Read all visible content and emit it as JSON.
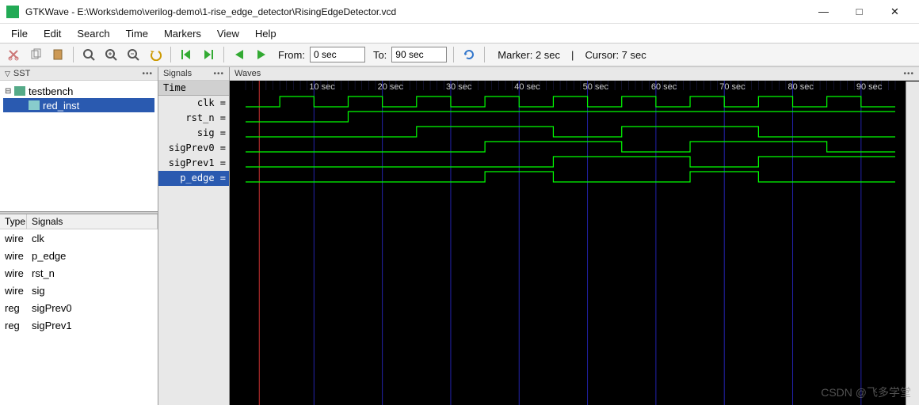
{
  "window": {
    "app": "GTKWave",
    "title": "GTKWave - E:\\Works\\demo\\verilog-demo\\1-rise_edge_detector\\RisingEdgeDetector.vcd"
  },
  "menu": [
    "File",
    "Edit",
    "Search",
    "Time",
    "Markers",
    "View",
    "Help"
  ],
  "toolbar": {
    "from_label": "From:",
    "from_value": "0 sec",
    "to_label": "To:",
    "to_value": "90 sec",
    "marker": "Marker: 2 sec",
    "cursor": "Cursor: 7 sec"
  },
  "panels": {
    "sst": "SST",
    "signals": "Signals",
    "waves": "Waves",
    "time": "Time"
  },
  "tree": {
    "testbench": "testbench",
    "red_inst": "red_inst"
  },
  "sigcols": {
    "type": "Type",
    "signals": "Signals"
  },
  "siglist": [
    {
      "t": "wire",
      "n": "clk"
    },
    {
      "t": "wire",
      "n": "p_edge"
    },
    {
      "t": "wire",
      "n": "rst_n"
    },
    {
      "t": "wire",
      "n": "sig"
    },
    {
      "t": "reg",
      "n": "sigPrev0"
    },
    {
      "t": "reg",
      "n": "sigPrev1"
    }
  ],
  "signames": [
    {
      "n": "clk =",
      "sel": false
    },
    {
      "n": "rst_n =",
      "sel": false
    },
    {
      "n": "sig =",
      "sel": false
    },
    {
      "n": "sigPrev0 =",
      "sel": false
    },
    {
      "n": "sigPrev1 =",
      "sel": false
    },
    {
      "n": "p_edge =",
      "sel": true
    }
  ],
  "chart_data": {
    "type": "digital-timeline",
    "x_unit": "sec",
    "x_range": [
      0,
      95
    ],
    "x_ticks": [
      10,
      20,
      30,
      40,
      50,
      60,
      70,
      80,
      90
    ],
    "tick_label_suffix": " sec",
    "grid_major": [
      10,
      20,
      30,
      40,
      50,
      60,
      70,
      80,
      90
    ],
    "grid_minor_step": 1,
    "cursor_marker": 2,
    "signals": [
      {
        "name": "clk",
        "edges": [
          0,
          5,
          10,
          15,
          20,
          25,
          30,
          35,
          40,
          45,
          50,
          55,
          60,
          65,
          70,
          75,
          80,
          85,
          90
        ],
        "initial": 0
      },
      {
        "name": "rst_n",
        "edges": [
          0,
          15
        ],
        "initial": 0
      },
      {
        "name": "sig",
        "edges": [
          0,
          25,
          45,
          55,
          75
        ],
        "initial": 0
      },
      {
        "name": "sigPrev0",
        "edges": [
          0,
          35,
          55,
          65,
          85
        ],
        "initial": 0
      },
      {
        "name": "sigPrev1",
        "edges": [
          0,
          45,
          65,
          75
        ],
        "initial": 0
      },
      {
        "name": "p_edge",
        "edges": [
          0,
          35,
          45,
          65,
          75
        ],
        "initial": 0
      }
    ]
  },
  "watermark": "CSDN @飞多学堂"
}
